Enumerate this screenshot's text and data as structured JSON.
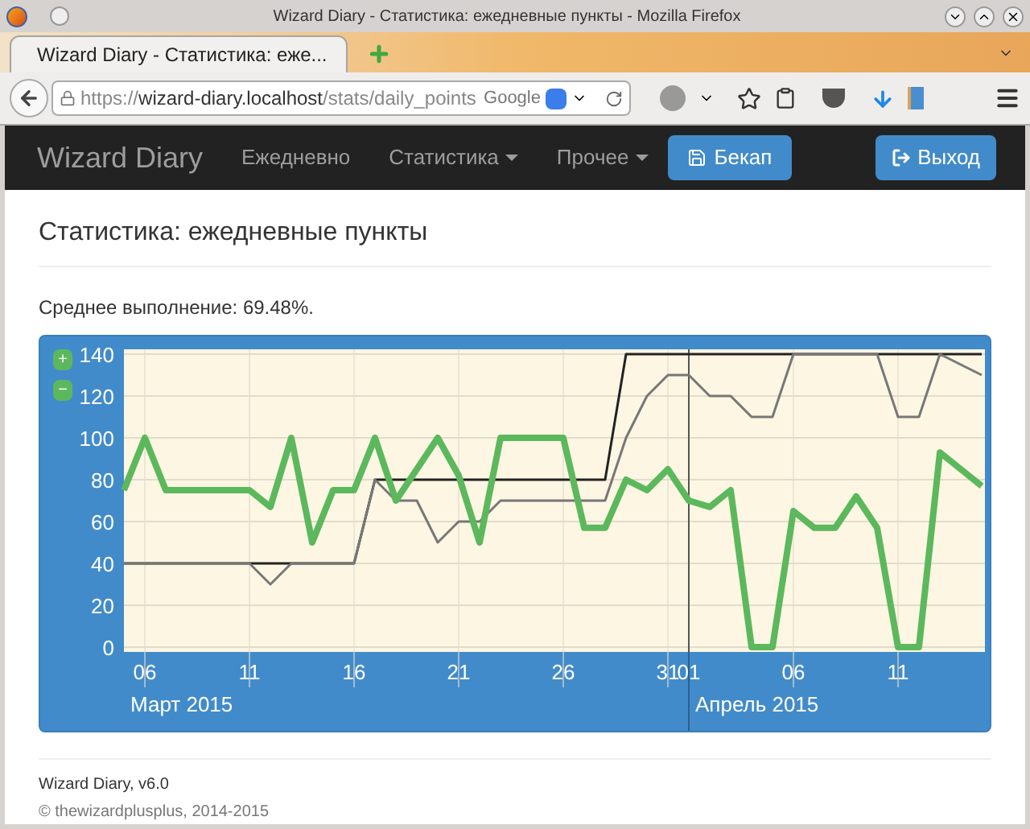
{
  "browser": {
    "window_title": "Wizard Diary - Статистика: ежедневные пункты - Mozilla Firefox",
    "tab_title": "Wizard Diary - Статистика: еже...",
    "url": {
      "scheme": "https://",
      "host": "wizard-diary.localhost",
      "path": "/stats/daily_points"
    },
    "search_engine": "Google"
  },
  "navbar": {
    "brand": "Wizard Diary",
    "items": [
      {
        "label": "Ежедневно",
        "dropdown": false
      },
      {
        "label": "Статистика",
        "dropdown": true
      },
      {
        "label": "Прочее",
        "dropdown": true
      }
    ],
    "backup_button": "Бекап",
    "logout_button": "Выход"
  },
  "page": {
    "title": "Статистика: ежедневные пункты",
    "summary": "Среднее выполнение: 69.48%."
  },
  "chart": {
    "zoom_in": "+",
    "zoom_out": "−",
    "month_labels": [
      "Март 2015",
      "Апрель 2015"
    ],
    "chart_data": {
      "type": "line",
      "categories": [
        null,
        "06",
        null,
        null,
        null,
        null,
        "11",
        null,
        null,
        null,
        null,
        "16",
        null,
        null,
        null,
        null,
        "21",
        null,
        null,
        null,
        null,
        "26",
        null,
        null,
        null,
        null,
        "31",
        "01",
        null,
        null,
        null,
        null,
        "06",
        null,
        null,
        null,
        null,
        "11",
        null,
        null,
        null,
        null
      ],
      "series": [
        {
          "color": "#222222",
          "values": [
            40,
            40,
            40,
            40,
            40,
            40,
            40,
            40,
            40,
            40,
            40,
            40,
            80,
            80,
            80,
            80,
            80,
            80,
            80,
            80,
            80,
            80,
            80,
            80,
            140,
            140,
            140,
            140,
            140,
            140,
            140,
            140,
            140,
            140,
            140,
            140,
            140,
            140,
            140,
            140,
            140,
            140
          ]
        },
        {
          "color": "#777777",
          "values": [
            40,
            40,
            40,
            40,
            40,
            40,
            40,
            30,
            40,
            40,
            40,
            40,
            80,
            70,
            70,
            50,
            60,
            60,
            70,
            70,
            70,
            70,
            70,
            70,
            100,
            120,
            130,
            130,
            120,
            120,
            110,
            110,
            140,
            140,
            140,
            140,
            140,
            110,
            110,
            140,
            135,
            130
          ]
        },
        {
          "color": "#5cb85c",
          "values": [
            75,
            100,
            75,
            75,
            75,
            75,
            75,
            67,
            100,
            50,
            75,
            75,
            100,
            70,
            85,
            100,
            82,
            50,
            100,
            100,
            100,
            100,
            57,
            57,
            80,
            75,
            85,
            70,
            67,
            75,
            0,
            0,
            65,
            57,
            57,
            72,
            57,
            0,
            0,
            93,
            85,
            77
          ]
        }
      ],
      "grid": true,
      "ylim": [
        0,
        140
      ],
      "yticks": [
        0,
        20,
        40,
        60,
        80,
        100,
        120,
        140
      ]
    }
  },
  "footer": {
    "version": "Wizard Diary, v6.0",
    "copyright": "© thewizardplusplus, 2014-2015"
  }
}
